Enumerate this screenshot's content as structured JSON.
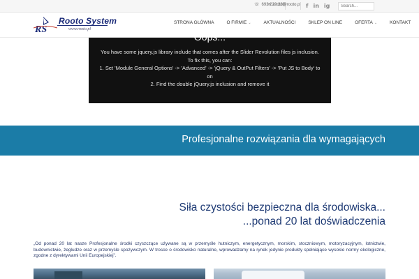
{
  "topbar": {
    "phone": "693 222 220",
    "email": "rooto@rooto.pl",
    "social": [
      "f",
      "in",
      "ig"
    ],
    "search_placeholder": "Search..."
  },
  "logo": {
    "mark": "RS",
    "title": "Rooto System",
    "subtitle": "www.rooto.pl"
  },
  "nav": {
    "items": [
      {
        "label": "STRONA GŁÓWNA"
      },
      {
        "label": "O FIRMIE",
        "caret": "⌄"
      },
      {
        "label": "AKTUALNOŚCI"
      },
      {
        "label": "SKLEP ON LINE"
      },
      {
        "label": "OFERTA",
        "caret": "⌄"
      },
      {
        "label": "KONTAKT"
      }
    ]
  },
  "error_box": {
    "title": "Oops...",
    "line1": "You have some jquery.js library include that comes after the Slider Revolution files js inclusion.",
    "line2": "To fix this, you can:",
    "line3": "1. Set 'Module General Options' -> 'Advanced' -> 'jQuery & OutPut Filters' -> 'Put JS to Body' to",
    "line4": "on",
    "line5": "2. Find the double jQuery.js inclusion and remove it"
  },
  "band": {
    "text": "Profesjonalne rozwiązania dla wymagających"
  },
  "headline": {
    "line1": "Siła czystości bezpieczna dla środowiska...",
    "line2": "...ponad 20 lat doświadczenia"
  },
  "intro": {
    "text": "„Od ponad 20 lat nasze Profesjonalne środki czyszczące używane są w przemyśle hutniczym, energetycznym, morskim, stoczniowym, motoryzacyjnym, lotnictwie, budownictwie, żegludze oraz w przemyśle spożywczym.  W trosce o środowisko naturalne, wprowadzamy na rynek jedynie produkty spełniające wysokie normy ekologiczne, zgodne z dyrektywami Unii Europejskiej”."
  },
  "colors": {
    "band": "#1b7ca7",
    "headline": "#1e3a74",
    "logo": "#1a2a78"
  }
}
